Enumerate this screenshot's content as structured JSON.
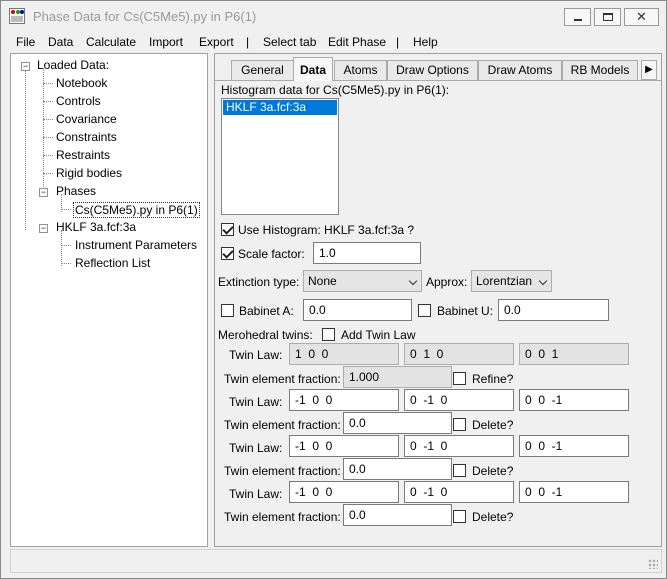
{
  "window": {
    "title": "Phase Data for Cs(C5Me5).py in P6(1)"
  },
  "menu": [
    "File",
    "Data",
    "Calculate",
    "Import",
    "Export",
    "|",
    "Select tab",
    "Edit Phase",
    "|",
    "Help"
  ],
  "tree": {
    "root": "Loaded Data:",
    "items": [
      "Notebook",
      "Controls",
      "Covariance",
      "Constraints",
      "Restraints",
      "Rigid bodies"
    ],
    "phases": {
      "label": "Phases",
      "child": "Cs(C5Me5).py in P6(1)"
    },
    "histogram": {
      "label": "HKLF 3a.fcf:3a",
      "children": [
        "Instrument Parameters",
        "Reflection List"
      ]
    }
  },
  "tabs": [
    "General",
    "Data",
    "Atoms",
    "Draw Options",
    "Draw Atoms",
    "RB Models"
  ],
  "data_tab": {
    "histogram_list_label": "Histogram data for Cs(C5Me5).py in P6(1):",
    "histograms": [
      "HKLF 3a.fcf:3a"
    ],
    "use_histogram": {
      "label": "Use Histogram: HKLF 3a.fcf:3a ?",
      "checked": true
    },
    "scale_factor": {
      "label": "Scale factor:",
      "value": "1.0",
      "checked": true
    },
    "extinction": {
      "label": "Extinction type:",
      "value": "None",
      "approx_label": "Approx:",
      "approx_value": "Lorentzian"
    },
    "babinet_a": {
      "label": "Babinet A:",
      "value": "0.0"
    },
    "babinet_u": {
      "label": "Babinet U:",
      "value": "0.0"
    },
    "merohedral": {
      "label": "Merohedral twins:",
      "add_label": "Add Twin Law"
    },
    "twin_law_label": "Twin Law:",
    "twin_fraction_label": "Twin element fraction:",
    "refine_label": "Refine?",
    "delete_label": "Delete?",
    "twins": [
      {
        "row1": "1  0  0",
        "row2": "0  1  0",
        "row3": "0  0  1",
        "fraction": "1.000"
      },
      {
        "row1": "-1  0  0",
        "row2": "0  -1  0",
        "row3": "0  0  -1",
        "fraction": "0.0"
      },
      {
        "row1": "-1  0  0",
        "row2": "0  -1  0",
        "row3": "0  0  -1",
        "fraction": "0.0"
      },
      {
        "row1": "-1  0  0",
        "row2": "0  -1  0",
        "row3": "0  0  -1",
        "fraction": "0.0"
      }
    ]
  }
}
